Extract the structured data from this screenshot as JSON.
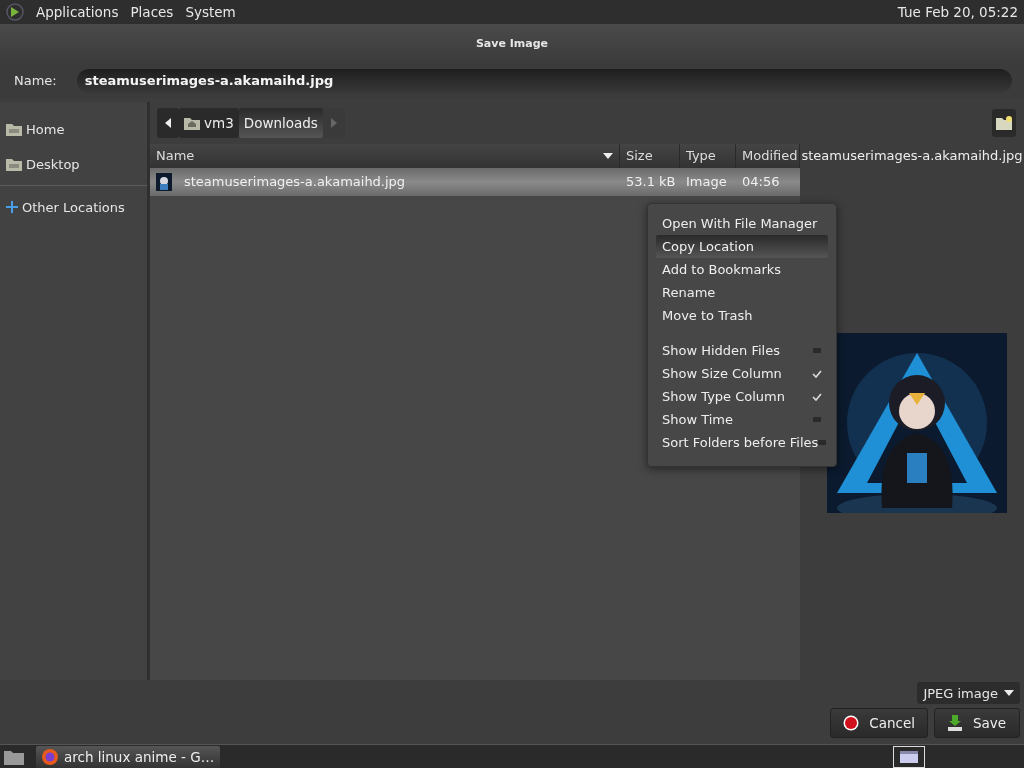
{
  "top_panel": {
    "menus": [
      "Applications",
      "Places",
      "System"
    ],
    "clock": "Tue Feb 20, 05:22"
  },
  "window": {
    "title": "Save Image"
  },
  "name_field": {
    "label": "Name:",
    "value": "steamuserimages-a.akamaihd.jpg"
  },
  "sidebar": {
    "items": [
      {
        "label": "Home",
        "kind": "folder",
        "selected": false
      },
      {
        "label": "Desktop",
        "kind": "folder",
        "selected": false
      },
      {
        "label": "Other Locations",
        "kind": "plus",
        "selected": false
      }
    ]
  },
  "path_bar": {
    "crumbs": [
      {
        "label": "vm3",
        "home": true,
        "selected": false
      },
      {
        "label": "Downloads",
        "home": false,
        "selected": true
      }
    ]
  },
  "table": {
    "columns": [
      "Name",
      "Size",
      "Type",
      "Modified"
    ],
    "rows": [
      {
        "name": "steamuserimages-a.akamaihd.jpg",
        "size": "53.1 kB",
        "type": "Image",
        "modified": "04:56",
        "selected": true
      }
    ]
  },
  "preview": {
    "caption": "steamuserimages-a.akamaihd.jpg",
    "kind": "picture"
  },
  "context_menu": {
    "items": [
      {
        "label": "Open With File Manager",
        "kind": "action",
        "selected": false
      },
      {
        "label": "Copy Location",
        "kind": "action",
        "selected": true
      },
      {
        "label": "Add to Bookmarks",
        "kind": "action",
        "selected": false
      },
      {
        "label": "Rename",
        "kind": "action",
        "selected": false
      },
      {
        "label": "Move to Trash",
        "kind": "action",
        "selected": false
      },
      {
        "label": "Show Hidden Files",
        "kind": "toggle",
        "checked": false,
        "selected": false
      },
      {
        "label": "Show Size Column",
        "kind": "toggle",
        "checked": true,
        "selected": false
      },
      {
        "label": "Show Type Column",
        "kind": "toggle",
        "checked": true,
        "selected": false
      },
      {
        "label": "Show Time",
        "kind": "toggle",
        "checked": false,
        "selected": false
      },
      {
        "label": "Sort Folders before Files",
        "kind": "toggle",
        "checked": false,
        "selected": false
      }
    ]
  },
  "filter": {
    "value": "JPEG image"
  },
  "buttons": [
    {
      "label": "Cancel",
      "kind": "cancel"
    },
    {
      "label": "Save",
      "kind": "save"
    }
  ],
  "taskbar": {
    "tasks": [
      {
        "label": "arch linux anime - G…",
        "selected": true
      }
    ]
  }
}
